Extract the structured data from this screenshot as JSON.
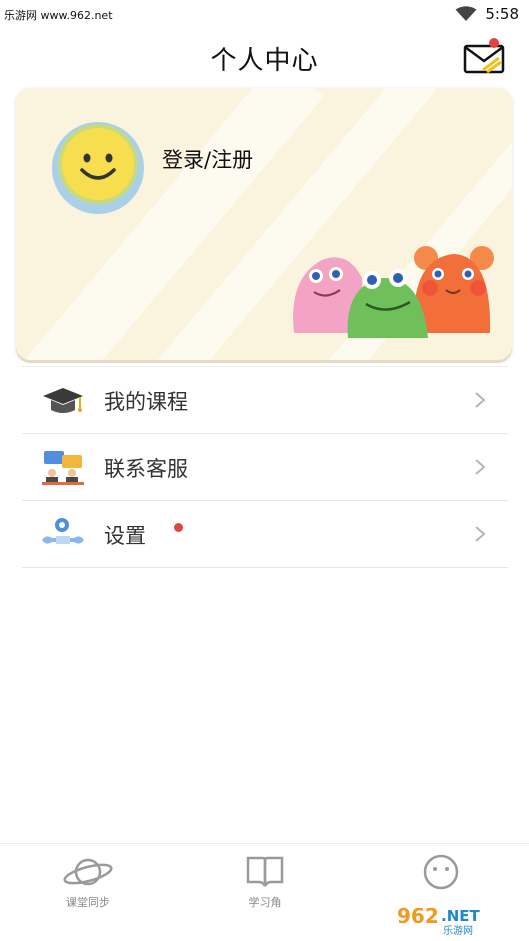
{
  "status_bar": {
    "source_text": "乐游网 www.962.net",
    "time": "5:58"
  },
  "header": {
    "title": "个人中心"
  },
  "profile": {
    "login_label": "登录/注册"
  },
  "menu": {
    "items": [
      {
        "label": "我的课程",
        "icon": "graduation-cap-icon"
      },
      {
        "label": "联系客服",
        "icon": "customer-service-icon"
      },
      {
        "label": "设置",
        "icon": "settings-wrench-icon",
        "has_badge": true
      }
    ]
  },
  "tabbar": {
    "tabs": [
      {
        "label": "课堂同步",
        "icon": "planet-icon"
      },
      {
        "label": "学习角",
        "icon": "book-icon"
      },
      {
        "label": "",
        "icon": "smiley-icon",
        "active": true
      }
    ]
  },
  "watermark": {
    "text": "962.NET 乐游网"
  },
  "colors": {
    "badge": "#e0463e",
    "card_bg": "#faf3de",
    "avatar_face": "#f7de4e"
  }
}
